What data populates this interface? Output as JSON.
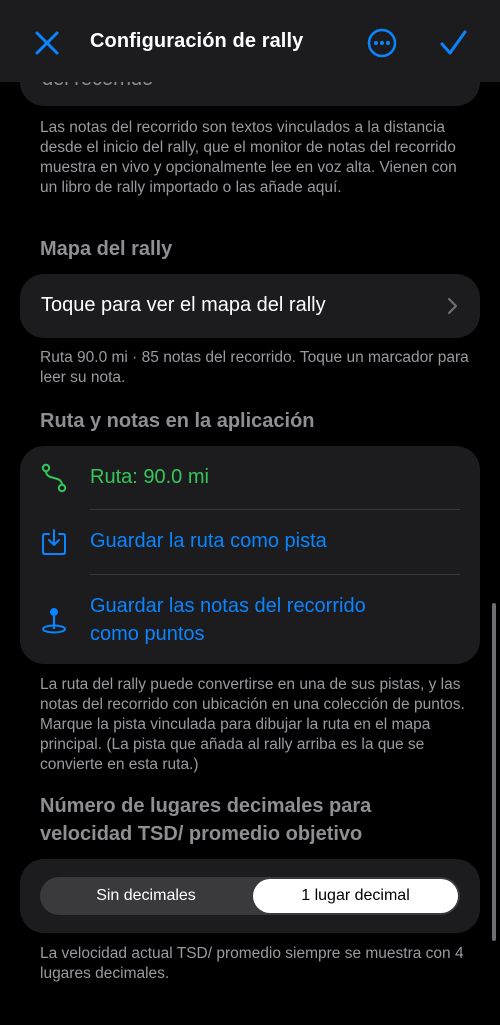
{
  "nav": {
    "title": "Configuración de rally",
    "close_icon": "close-icon",
    "more_icon": "ellipsis-circle-icon",
    "done_icon": "checkmark-icon"
  },
  "top_group": {
    "partial_text": "del recorrido"
  },
  "notes_footer": "Las notas del recorrido son textos vinculados a la distancia desde el inicio del rally, que el monitor de notas del recorrido muestra en vivo y opcionalmente lee en voz alta. Vienen con un libro de rally importado o las añade aquí.",
  "map_section": {
    "header": "Mapa del rally",
    "row_label": "Toque para ver el mapa del rally",
    "footer": "Ruta 90.0 mi · 85 notas del recorrido. Toque un marcador para leer su nota."
  },
  "app_section": {
    "header": "Ruta y notas en la aplicación",
    "rows": [
      {
        "label": "Ruta: 90.0 mi",
        "icon": "route-icon",
        "color": "#33c759"
      },
      {
        "label": "Guardar la ruta como pista",
        "icon": "tray-download-icon",
        "color": "#0a84ff"
      },
      {
        "label": "Guardar las notas del recorrido como puntos",
        "icon": "map-pin-icon",
        "color": "#0a84ff"
      }
    ],
    "footer": "La ruta del rally puede convertirse en una de sus pistas, y las notas del recorrido con ubicación en una colección de puntos. Marque la pista vinculada para dibujar la ruta en el mapa principal. (La pista que añada al rally arriba es la que se convierte en esta ruta.)"
  },
  "decimals_section": {
    "header": "Número de lugares decimales para velocidad TSD/ promedio objetivo",
    "options": [
      "Sin decimales",
      "1 lugar decimal"
    ],
    "selected": "1 lugar decimal",
    "footer": "La velocidad actual TSD/ promedio siempre se muestra con 4 lugares decimales."
  },
  "colors": {
    "accent": "#0a84ff",
    "green": "#33c759",
    "background": "#000000",
    "group": "#1c1c1e"
  }
}
